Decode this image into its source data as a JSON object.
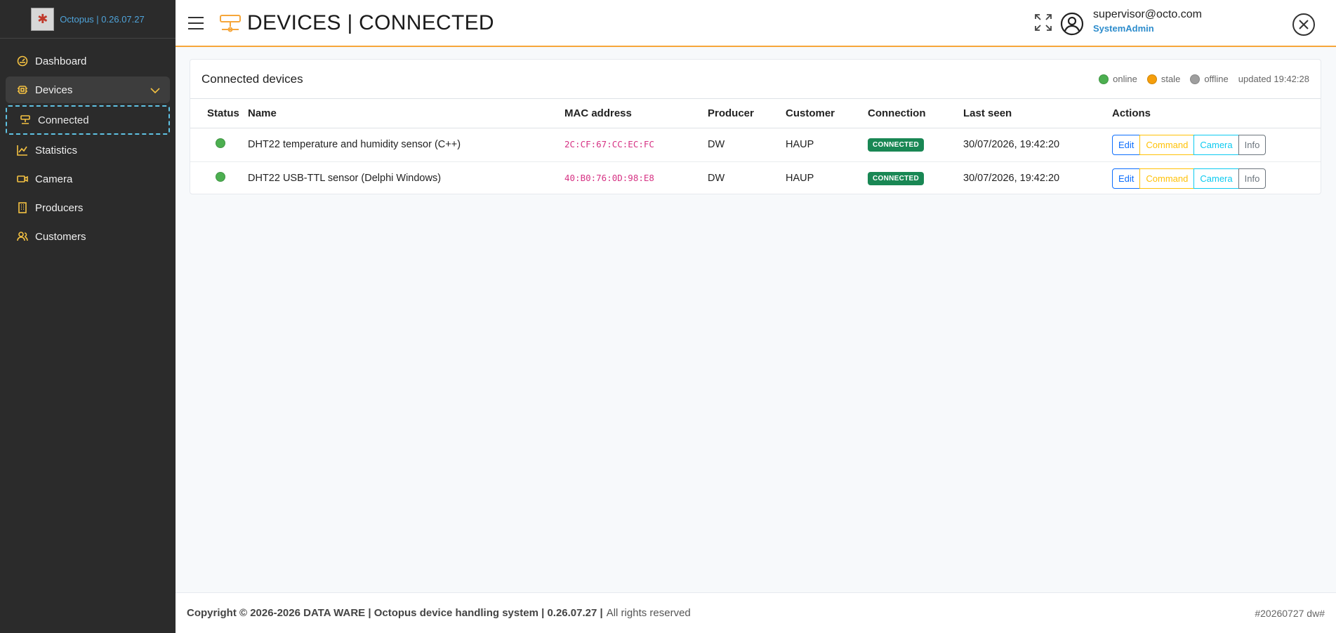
{
  "brand": {
    "text": "Octopus | 0.26.07.27",
    "logo": "octopus-logo"
  },
  "sidebar": {
    "items": [
      {
        "label": "Dashboard",
        "icon": "dashboard-icon"
      },
      {
        "label": "Devices",
        "icon": "chip-icon"
      },
      {
        "label": "Connected",
        "icon": "network-icon"
      },
      {
        "label": "Statistics",
        "icon": "chart-icon"
      },
      {
        "label": "Camera",
        "icon": "camera-icon"
      },
      {
        "label": "Producers",
        "icon": "building-icon"
      },
      {
        "label": "Customers",
        "icon": "people-icon"
      }
    ]
  },
  "header": {
    "title": "DEVICES | CONNECTED",
    "user_email": "supervisor@octo.com",
    "user_role": "SystemAdmin"
  },
  "card": {
    "title": "Connected devices",
    "legend": {
      "online": "online",
      "stale": "stale",
      "offline": "offline",
      "updated": "updated 19:42:28"
    },
    "columns": [
      "Status",
      "Name",
      "MAC address",
      "Producer",
      "Customer",
      "Connection",
      "Last seen",
      "Actions"
    ],
    "rows": [
      {
        "name": "DHT22 temperature and humidity sensor (C++)",
        "mac": "2C:CF:67:CC:EC:FC",
        "producer": "DW",
        "customer": "HAUP",
        "connection": "CONNECTED",
        "last_seen": "30/07/2026, 19:42:20"
      },
      {
        "name": "DHT22 USB-TTL sensor (Delphi Windows)",
        "mac": "40:B0:76:0D:98:E8",
        "producer": "DW",
        "customer": "HAUP",
        "connection": "CONNECTED",
        "last_seen": "30/07/2026, 19:42:20"
      }
    ],
    "actions": {
      "edit": "Edit",
      "command": "Command",
      "camera": "Camera",
      "info": "Info"
    }
  },
  "footer": {
    "copyright": "Copyright © 2026-2026 DATA WARE | Octopus device handling system | 0.26.07.27 |",
    "rights": "All rights reserved",
    "build": "#20260727 dw#"
  },
  "colors": {
    "online": "#4caf50",
    "stale": "#f59e0b",
    "offline": "#9e9e9e",
    "accent": "#f6a63a",
    "link": "#2c8ccc"
  }
}
